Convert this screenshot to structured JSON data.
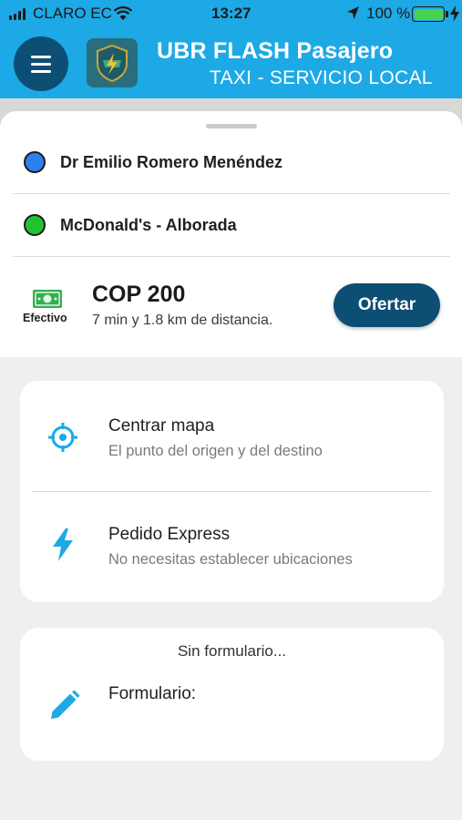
{
  "status_bar": {
    "carrier": "CLARO EC",
    "time": "13:27",
    "battery_percent": "100 %",
    "battery_color": "#47d34f"
  },
  "header": {
    "menu_icon": "hamburger-menu-icon",
    "title": "UBR FLASH Pasajero",
    "subtitle": "TAXI - SERVICIO LOCAL",
    "background_color": "#1da9e6",
    "accent_color": "#0d4e74"
  },
  "trip": {
    "origin": {
      "label": "Dr Emilio Romero Menéndez",
      "dot_color": "#2f7ff0"
    },
    "destination": {
      "label": "McDonald's - Alborada",
      "dot_color": "#22c132"
    },
    "payment_method": "Efectivo",
    "payment_icon": "cash-icon",
    "price": "COP 200",
    "info": "7 min y 1.8 km de distancia.",
    "offer_button": "Ofertar"
  },
  "options": [
    {
      "icon": "crosshair-icon",
      "title": "Centrar mapa",
      "subtitle": "El punto del origen y del destino"
    },
    {
      "icon": "lightning-icon",
      "title": "Pedido Express",
      "subtitle": "No necesitas establecer ubicaciones"
    }
  ],
  "form": {
    "header": "Sin formulario...",
    "icon": "pencil-icon",
    "label": "Formulario:"
  },
  "icon_color": "#1da9e6"
}
